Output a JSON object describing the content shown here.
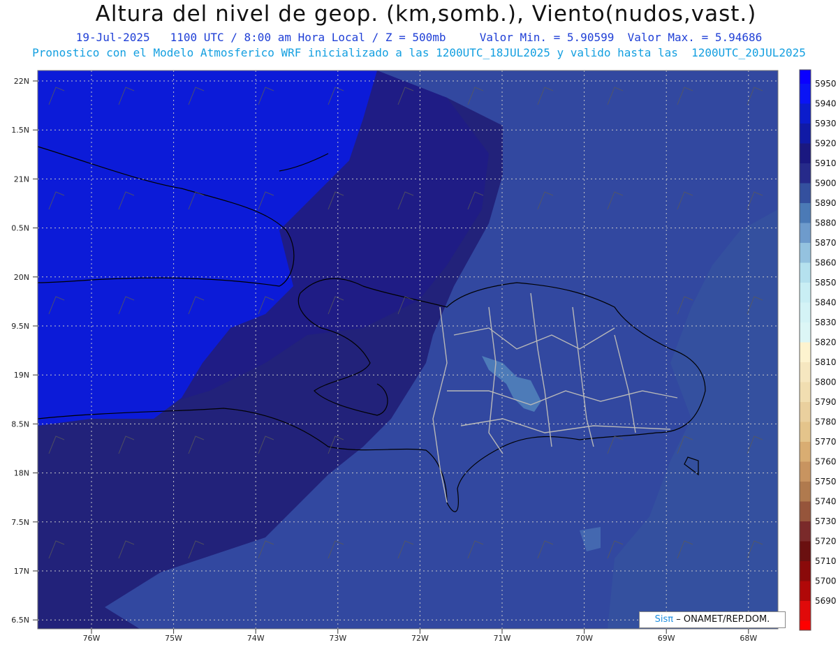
{
  "header": {
    "title": "Altura del nivel de geop. (km,somb.), Viento(nudos,vast.)",
    "subtitle1": "19-Jul-2025   1100 UTC / 8:00 am Hora Local / Z = 500mb     Valor Min. = 5.90599  Valor Max. = 5.94686",
    "subtitle2": "Pronostico con el Modelo Atmosferico WRF inicializado a las 1200UTC_18JUL2025 y valido hasta las  1200UTC_20JUL2025"
  },
  "axes": {
    "lat_labels": [
      "22N",
      "1.5N",
      "21N",
      "0.5N",
      "20N",
      "9.5N",
      "19N",
      "8.5N",
      "18N",
      "7.5N",
      "17N",
      "6.5N"
    ],
    "lon_labels": [
      "76W",
      "75W",
      "74W",
      "73W",
      "72W",
      "71W",
      "70W",
      "69W",
      "68W"
    ]
  },
  "colorbar": {
    "levels": [
      "5950",
      "5940",
      "5930",
      "5920",
      "5910",
      "5900",
      "5890",
      "5880",
      "5870",
      "5860",
      "5850",
      "5840",
      "5830",
      "5820",
      "5810",
      "5800",
      "5790",
      "5780",
      "5770",
      "5760",
      "5750",
      "5740",
      "5730",
      "5720",
      "5710",
      "5700",
      "5690"
    ],
    "colors": [
      "#0a14f5",
      "#0b1ccc",
      "#101aa6",
      "#1a1880",
      "#262a8a",
      "#34509e",
      "#4b7ab6",
      "#6e9bcc",
      "#94c2df",
      "#b5e1ee",
      "#c9eef4",
      "#d4f3f6",
      "#dcf6f6",
      "#fdf3cf",
      "#f6e7c0",
      "#f1deb1",
      "#ead09e",
      "#e4c48b",
      "#d9ad72",
      "#c89460",
      "#b07a4e",
      "#96553b",
      "#7a2a2a",
      "#6a1010",
      "#8a0a0a",
      "#b00808",
      "#e00a0a"
    ],
    "top_color": "#0a00ff",
    "bottom_color": "#ff0000"
  },
  "fields": {
    "ocean_east": "#3248a0",
    "mid_zone": "#22227a",
    "high_zone": "#1f1c85",
    "max_zone": "#0c1bd8",
    "low_light": "#4d7bb8"
  },
  "credit": {
    "brand": "Sisπ",
    "text": "– ONAMET/REP.DOM."
  }
}
